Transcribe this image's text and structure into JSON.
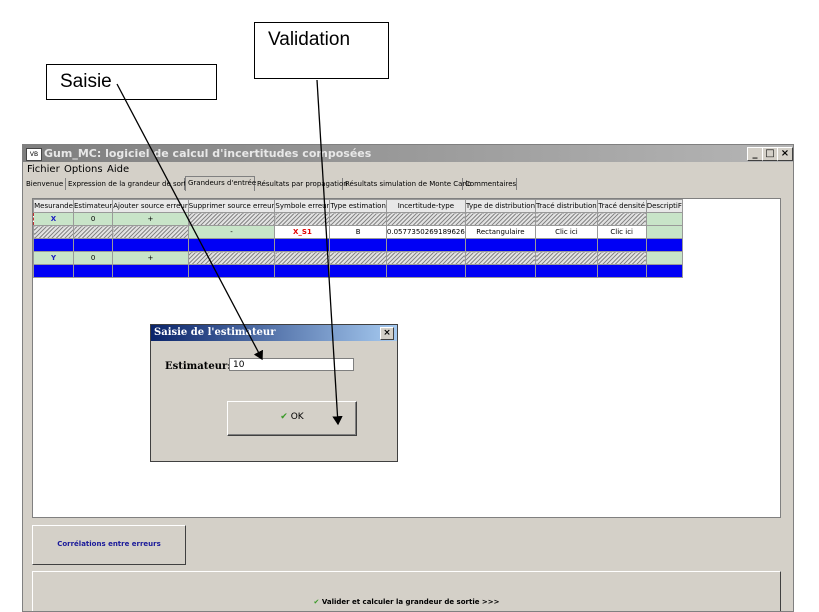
{
  "callouts": {
    "saisie": "Saisie",
    "validation": "Validation"
  },
  "window": {
    "app_icon": "VB",
    "title": "Gum_MC: logiciel de calcul d'incertitudes composées",
    "controls": {
      "minimize": "_",
      "maximize": "□",
      "close": "×"
    }
  },
  "menu": [
    "Fichier",
    "Options",
    "Aide"
  ],
  "tabs": [
    "Bienvenue",
    "Expression de la grandeur de sortie",
    "Grandeurs d'entrée",
    "Résultats par propagation",
    "Résultats simulation de Monte Carlo",
    "Commentaires"
  ],
  "active_tab": "Grandeurs d'entrée",
  "table": {
    "headers": [
      "Mesurande",
      "Estimateur",
      "Ajouter source erreur",
      "Supprimer source erreur",
      "Symbole erreur",
      "Type estimation",
      "Incertitude-type",
      "Type de distribution",
      "Tracé distribution",
      "Tracé densité",
      "DescriptiF"
    ],
    "row_x": {
      "mesurande": "X",
      "estimateur": "0",
      "ajouter": "+"
    },
    "row_err": {
      "supprimer": "-",
      "symbole": "X_S1",
      "type": "B",
      "incertitude": "0.0577350269189626",
      "distribution": "Rectangulaire",
      "trace_distribution": "Clic ici",
      "trace_densite": "Clic ici"
    },
    "row_y": {
      "mesurande": "Y",
      "estimateur": "0",
      "ajouter": "+"
    }
  },
  "dialog": {
    "title": "Saisie de l'estimateur",
    "close": "×",
    "label": "Estimateur:",
    "value": "10",
    "ok_label": "OK"
  },
  "buttons": {
    "correlations": "Corrélations entre erreurs",
    "validate": "Valider et calculer la grandeur de sortie >>>"
  },
  "colors": {
    "accent_blue": "#0000f5",
    "green_cell": "#c8e4c8",
    "check_green": "#3a9a28",
    "error_red": "#e00000"
  }
}
